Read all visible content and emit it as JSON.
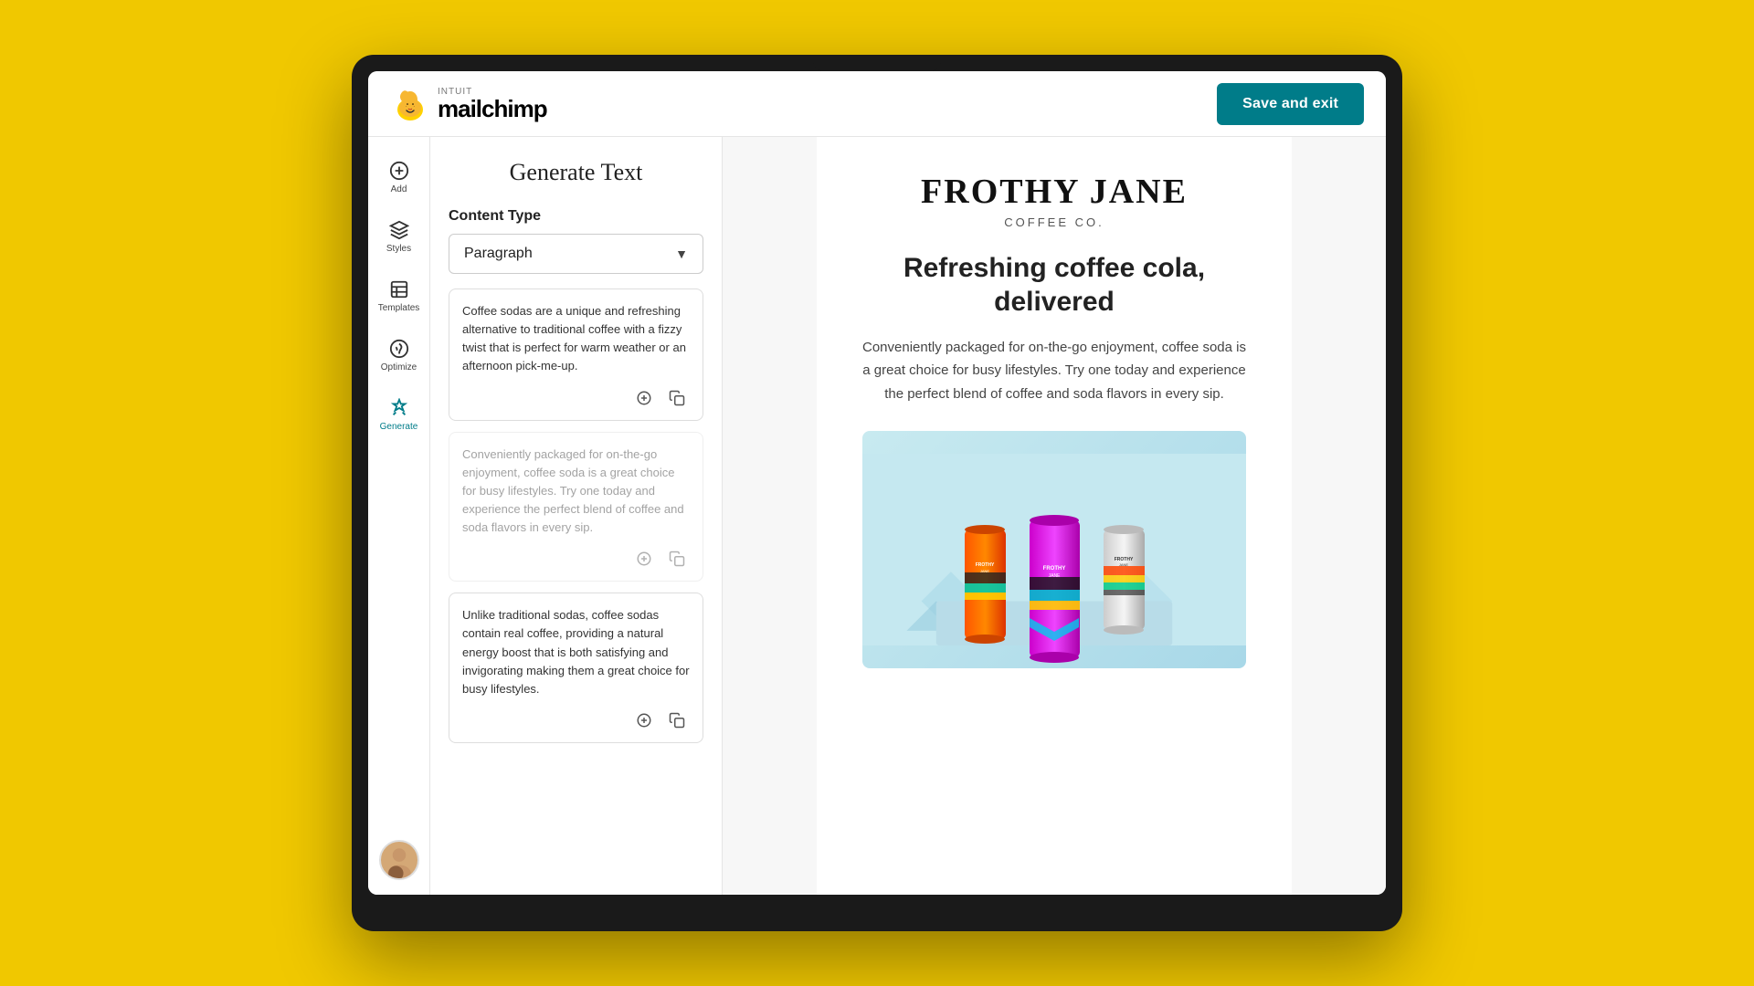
{
  "header": {
    "logo_intuit": "INTUIT",
    "logo_mailchimp": "mailchimp",
    "save_exit_label": "Save and exit"
  },
  "sidebar": {
    "items": [
      {
        "id": "add",
        "label": "Add",
        "active": false
      },
      {
        "id": "styles",
        "label": "Styles",
        "active": false
      },
      {
        "id": "templates",
        "label": "Templates",
        "active": false
      },
      {
        "id": "optimize",
        "label": "Optimize",
        "active": false
      },
      {
        "id": "generate",
        "label": "Generate",
        "active": true
      }
    ]
  },
  "generate_panel": {
    "title": "Generate Text",
    "content_type_label": "Content Type",
    "dropdown_value": "Paragraph",
    "cards": [
      {
        "id": "card1",
        "text": "Coffee sodas are a unique and refreshing alternative to traditional coffee with a fizzy twist that is perfect for warm weather or an afternoon pick-me-up.",
        "dimmed": false
      },
      {
        "id": "card2",
        "text": "Conveniently packaged for on-the-go enjoyment, coffee soda is a great choice for busy lifestyles. Try one today and experience the perfect blend of coffee and soda flavors in every sip.",
        "dimmed": true
      },
      {
        "id": "card3",
        "text": "Unlike traditional sodas, coffee sodas contain real coffee, providing a natural energy boost that is both satisfying and invigorating making them a great choice for busy lifestyles.",
        "dimmed": false
      }
    ]
  },
  "email_preview": {
    "brand_name": "FROTHY JANE",
    "brand_sub": "COFFEE CO.",
    "headline": "Refreshing coffee cola, delivered",
    "body": "Conveniently packaged for on-the-go enjoyment, coffee soda is a great choice for busy lifestyles. Try one today and experience the perfect blend of coffee and soda flavors in every sip."
  }
}
